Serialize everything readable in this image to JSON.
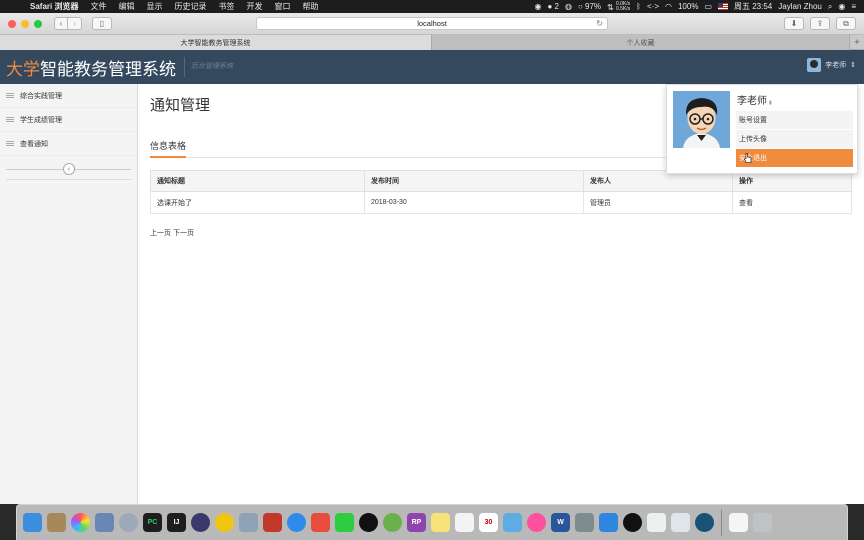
{
  "menubar": {
    "apple_icon": "apple-icon",
    "app_name": "Safari 浏览器",
    "menus": [
      "文件",
      "编辑",
      "显示",
      "历史记录",
      "书签",
      "开发",
      "窗口",
      "帮助"
    ],
    "status": {
      "notification_count": "2",
      "battery_top": "97%",
      "net_up": "0.0K/s",
      "net_down": "0.5K/s",
      "battery": "100%",
      "datetime": "周五 23:54",
      "user": "Jaylan Zhou"
    }
  },
  "browser": {
    "url": "localhost",
    "tabs": [
      {
        "label": "大学智能教务管理系统",
        "active": true
      },
      {
        "label": "个人收藏",
        "active": false
      }
    ]
  },
  "app": {
    "title_accent": "大学",
    "title_rest": "智能教务管理系统",
    "subtitle": "后台管理系统",
    "user_name": "李老师",
    "accent_color": "#f08a3e",
    "header_color": "#34495e"
  },
  "sidebar": {
    "items": [
      {
        "label": "综合实践管理"
      },
      {
        "label": "学生成绩管理"
      },
      {
        "label": "查看通知"
      }
    ],
    "collapse_icon": "‹"
  },
  "main": {
    "heading": "通知管理",
    "section_tab": "信息表格",
    "table": {
      "headers": [
        "通知标题",
        "发布时间",
        "发布人",
        "操作"
      ],
      "rows": [
        [
          "选课开始了",
          "2018-03-30",
          "管理员",
          "查看"
        ]
      ]
    },
    "pager": {
      "prev": "上一页",
      "next": "下一页"
    }
  },
  "user_dropdown": {
    "name": "李老师",
    "items": [
      {
        "label": "账号设置"
      },
      {
        "label": "上传头像"
      },
      {
        "label": "安全退出"
      }
    ]
  }
}
